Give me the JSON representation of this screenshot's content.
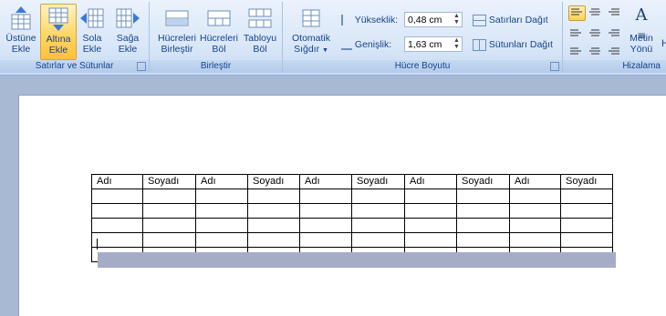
{
  "ribbon": {
    "rows_cols": {
      "label": "Satırlar ve Sütunlar",
      "buttons": [
        {
          "l1": "Üstüne",
          "l2": "Ekle"
        },
        {
          "l1": "Altına",
          "l2": "Ekle"
        },
        {
          "l1": "Sola",
          "l2": "Ekle"
        },
        {
          "l1": "Sağa",
          "l2": "Ekle"
        }
      ]
    },
    "merge": {
      "label": "Birleştir",
      "buttons": [
        {
          "l1": "Hücreleri",
          "l2": "Birleştir"
        },
        {
          "l1": "Hücreleri",
          "l2": "Böl"
        },
        {
          "l1": "Tabloyu",
          "l2": "Böl"
        }
      ]
    },
    "cell_size": {
      "label": "Hücre Boyutu",
      "autofit": {
        "l1": "Otomatik",
        "l2": "Sığdır"
      },
      "height_label": "Yükseklik:",
      "height_value": "0,48 cm",
      "width_label": "Genişlik:",
      "width_value": "1,63 cm",
      "distribute_rows": "Satırları Dağıt",
      "distribute_cols": "Sütunları Dağıt"
    },
    "alignment": {
      "label": "Hizalama",
      "text_direction": {
        "l1": "Metin",
        "l2": "Yönü"
      },
      "cut_letter": "H"
    }
  },
  "table": {
    "headers": [
      "Adı",
      "Soyadı",
      "Adı",
      "Soyadı",
      "Adı",
      "Soyadı",
      "Adı",
      "Soyadı",
      "Adı",
      "Soyadı"
    ]
  }
}
